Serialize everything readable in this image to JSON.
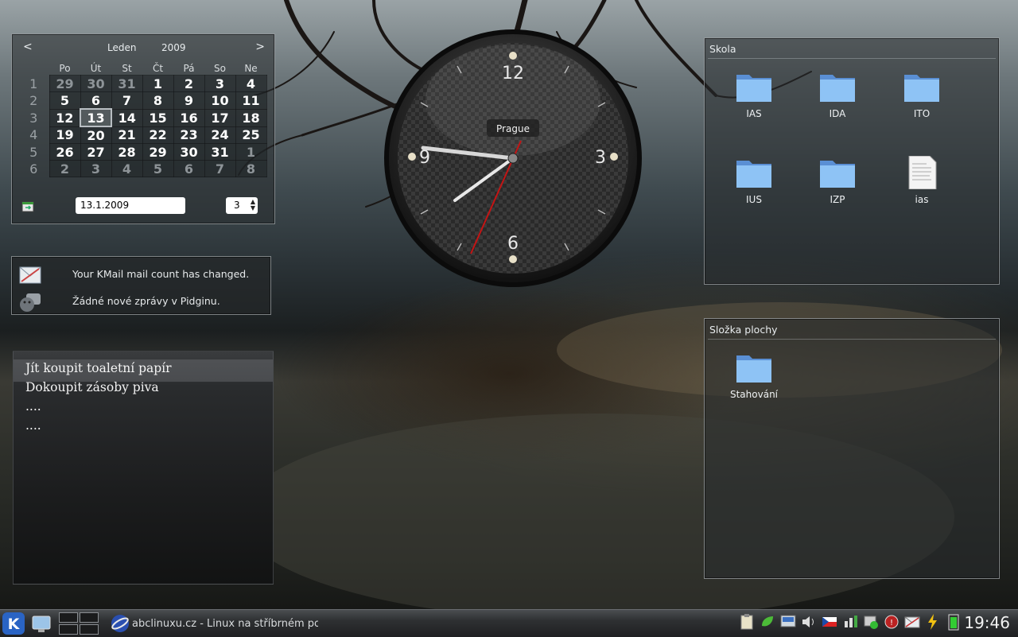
{
  "calendar": {
    "prev": "<",
    "next": ">",
    "month": "Leden",
    "year": "2009",
    "weekdays": [
      "Po",
      "Út",
      "St",
      "Čt",
      "Pá",
      "So",
      "Ne"
    ],
    "weeks": [
      {
        "wk": "1",
        "days": [
          "29",
          "30",
          "31",
          "1",
          "2",
          "3",
          "4"
        ]
      },
      {
        "wk": "2",
        "days": [
          "5",
          "6",
          "7",
          "8",
          "9",
          "10",
          "11"
        ]
      },
      {
        "wk": "3",
        "days": [
          "12",
          "13",
          "14",
          "15",
          "16",
          "17",
          "18"
        ]
      },
      {
        "wk": "4",
        "days": [
          "19",
          "20",
          "21",
          "22",
          "23",
          "24",
          "25"
        ]
      },
      {
        "wk": "5",
        "days": [
          "26",
          "27",
          "28",
          "29",
          "30",
          "31",
          "1"
        ]
      },
      {
        "wk": "6",
        "days": [
          "2",
          "3",
          "4",
          "5",
          "6",
          "7",
          "8"
        ]
      }
    ],
    "date_value": "13.1.2009",
    "week_value": "3"
  },
  "notifications": {
    "kmail": "Your KMail mail count has changed.",
    "pidgin": "Žádné nové zprávy v Pidginu."
  },
  "notes": {
    "lines": [
      "Jít koupit toaletní papír",
      "Dokoupit zásoby piva",
      "....",
      "...."
    ]
  },
  "clock": {
    "city": "Prague",
    "numerals": [
      "12",
      "3",
      "6",
      "9"
    ]
  },
  "folder_skola": {
    "title": "Skola",
    "items": [
      {
        "label": "IAS",
        "icon": "folder-icon"
      },
      {
        "label": "IDA",
        "icon": "folder-icon"
      },
      {
        "label": "ITO",
        "icon": "folder-icon"
      },
      {
        "label": "IUS",
        "icon": "folder-icon"
      },
      {
        "label": "IZP",
        "icon": "folder-icon"
      },
      {
        "label": "ias",
        "icon": "text-document-icon"
      }
    ]
  },
  "folder_plochy": {
    "title": "Složka plochy",
    "items": [
      {
        "label": "Stahování",
        "icon": "folder-icon"
      }
    ]
  },
  "taskbar": {
    "task_title": "abclinuxu.cz - Linux na stříbrném podnose",
    "time": "19:46"
  }
}
